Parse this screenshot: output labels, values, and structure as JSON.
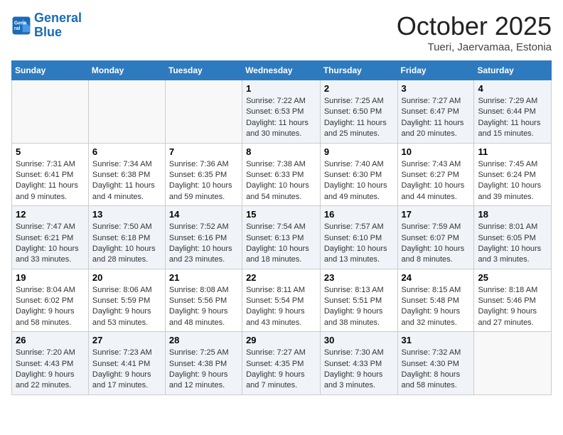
{
  "logo": {
    "line1": "General",
    "line2": "Blue"
  },
  "title": "October 2025",
  "location": "Tueri, Jaervamaa, Estonia",
  "days_header": [
    "Sunday",
    "Monday",
    "Tuesday",
    "Wednesday",
    "Thursday",
    "Friday",
    "Saturday"
  ],
  "weeks": [
    [
      {
        "day": "",
        "info": ""
      },
      {
        "day": "",
        "info": ""
      },
      {
        "day": "",
        "info": ""
      },
      {
        "day": "1",
        "info": "Sunrise: 7:22 AM\nSunset: 6:53 PM\nDaylight: 11 hours and 30 minutes."
      },
      {
        "day": "2",
        "info": "Sunrise: 7:25 AM\nSunset: 6:50 PM\nDaylight: 11 hours and 25 minutes."
      },
      {
        "day": "3",
        "info": "Sunrise: 7:27 AM\nSunset: 6:47 PM\nDaylight: 11 hours and 20 minutes."
      },
      {
        "day": "4",
        "info": "Sunrise: 7:29 AM\nSunset: 6:44 PM\nDaylight: 11 hours and 15 minutes."
      }
    ],
    [
      {
        "day": "5",
        "info": "Sunrise: 7:31 AM\nSunset: 6:41 PM\nDaylight: 11 hours and 9 minutes."
      },
      {
        "day": "6",
        "info": "Sunrise: 7:34 AM\nSunset: 6:38 PM\nDaylight: 11 hours and 4 minutes."
      },
      {
        "day": "7",
        "info": "Sunrise: 7:36 AM\nSunset: 6:35 PM\nDaylight: 10 hours and 59 minutes."
      },
      {
        "day": "8",
        "info": "Sunrise: 7:38 AM\nSunset: 6:33 PM\nDaylight: 10 hours and 54 minutes."
      },
      {
        "day": "9",
        "info": "Sunrise: 7:40 AM\nSunset: 6:30 PM\nDaylight: 10 hours and 49 minutes."
      },
      {
        "day": "10",
        "info": "Sunrise: 7:43 AM\nSunset: 6:27 PM\nDaylight: 10 hours and 44 minutes."
      },
      {
        "day": "11",
        "info": "Sunrise: 7:45 AM\nSunset: 6:24 PM\nDaylight: 10 hours and 39 minutes."
      }
    ],
    [
      {
        "day": "12",
        "info": "Sunrise: 7:47 AM\nSunset: 6:21 PM\nDaylight: 10 hours and 33 minutes."
      },
      {
        "day": "13",
        "info": "Sunrise: 7:50 AM\nSunset: 6:18 PM\nDaylight: 10 hours and 28 minutes."
      },
      {
        "day": "14",
        "info": "Sunrise: 7:52 AM\nSunset: 6:16 PM\nDaylight: 10 hours and 23 minutes."
      },
      {
        "day": "15",
        "info": "Sunrise: 7:54 AM\nSunset: 6:13 PM\nDaylight: 10 hours and 18 minutes."
      },
      {
        "day": "16",
        "info": "Sunrise: 7:57 AM\nSunset: 6:10 PM\nDaylight: 10 hours and 13 minutes."
      },
      {
        "day": "17",
        "info": "Sunrise: 7:59 AM\nSunset: 6:07 PM\nDaylight: 10 hours and 8 minutes."
      },
      {
        "day": "18",
        "info": "Sunrise: 8:01 AM\nSunset: 6:05 PM\nDaylight: 10 hours and 3 minutes."
      }
    ],
    [
      {
        "day": "19",
        "info": "Sunrise: 8:04 AM\nSunset: 6:02 PM\nDaylight: 9 hours and 58 minutes."
      },
      {
        "day": "20",
        "info": "Sunrise: 8:06 AM\nSunset: 5:59 PM\nDaylight: 9 hours and 53 minutes."
      },
      {
        "day": "21",
        "info": "Sunrise: 8:08 AM\nSunset: 5:56 PM\nDaylight: 9 hours and 48 minutes."
      },
      {
        "day": "22",
        "info": "Sunrise: 8:11 AM\nSunset: 5:54 PM\nDaylight: 9 hours and 43 minutes."
      },
      {
        "day": "23",
        "info": "Sunrise: 8:13 AM\nSunset: 5:51 PM\nDaylight: 9 hours and 38 minutes."
      },
      {
        "day": "24",
        "info": "Sunrise: 8:15 AM\nSunset: 5:48 PM\nDaylight: 9 hours and 32 minutes."
      },
      {
        "day": "25",
        "info": "Sunrise: 8:18 AM\nSunset: 5:46 PM\nDaylight: 9 hours and 27 minutes."
      }
    ],
    [
      {
        "day": "26",
        "info": "Sunrise: 7:20 AM\nSunset: 4:43 PM\nDaylight: 9 hours and 22 minutes."
      },
      {
        "day": "27",
        "info": "Sunrise: 7:23 AM\nSunset: 4:41 PM\nDaylight: 9 hours and 17 minutes."
      },
      {
        "day": "28",
        "info": "Sunrise: 7:25 AM\nSunset: 4:38 PM\nDaylight: 9 hours and 12 minutes."
      },
      {
        "day": "29",
        "info": "Sunrise: 7:27 AM\nSunset: 4:35 PM\nDaylight: 9 hours and 7 minutes."
      },
      {
        "day": "30",
        "info": "Sunrise: 7:30 AM\nSunset: 4:33 PM\nDaylight: 9 hours and 3 minutes."
      },
      {
        "day": "31",
        "info": "Sunrise: 7:32 AM\nSunset: 4:30 PM\nDaylight: 8 hours and 58 minutes."
      },
      {
        "day": "",
        "info": ""
      }
    ]
  ]
}
